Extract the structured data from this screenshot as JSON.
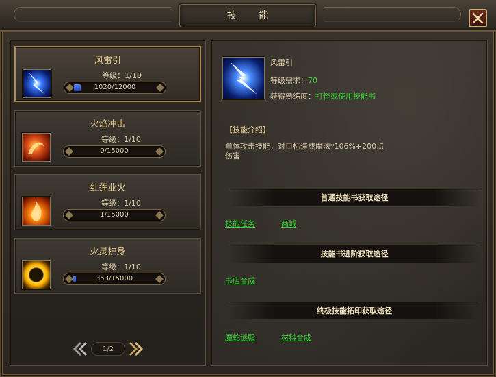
{
  "window": {
    "title": "技  能",
    "close_label": "close"
  },
  "skills": [
    {
      "name": "风雷引",
      "level": "等级：1/10",
      "xp_text": "1020/12000",
      "progress": 0.085,
      "icon": "lightning-icon",
      "selected": true
    },
    {
      "name": "火焰冲击",
      "level": "等级：1/10",
      "xp_text": "0/15000",
      "progress": 0.0,
      "icon": "fire-swirl-icon",
      "selected": false
    },
    {
      "name": "红莲业火",
      "level": "等级：1/10",
      "xp_text": "1/15000",
      "progress": 0.0,
      "icon": "flame-icon",
      "selected": false
    },
    {
      "name": "火灵护身",
      "level": "等级：1/10",
      "xp_text": "353/15000",
      "progress": 0.024,
      "icon": "fire-shield-icon",
      "selected": false
    }
  ],
  "pager": {
    "text": "1/2"
  },
  "detail": {
    "name": "风雷引",
    "req_label": "等级需求：",
    "req_value": "70",
    "gain_label": "获得熟练度：",
    "gain_value": "打怪或使用技能书",
    "intro_title": "【技能介绍】",
    "intro_text": "单体攻击技能，对目标造成魔法*106%+200点伤害"
  },
  "sections": [
    {
      "title": "普通技能书获取途径",
      "links": [
        "技能任务",
        "商城"
      ]
    },
    {
      "title": "技能书进阶获取途径",
      "links": [
        "书店合成"
      ]
    },
    {
      "title": "终极技能拓印获取途径",
      "links": [
        "魔蛇谜殿",
        "材料合成"
      ]
    }
  ],
  "colors": {
    "accent_gold": "#e6c98e",
    "link_green": "#38d238",
    "xp_blue": "#3a6cff"
  }
}
